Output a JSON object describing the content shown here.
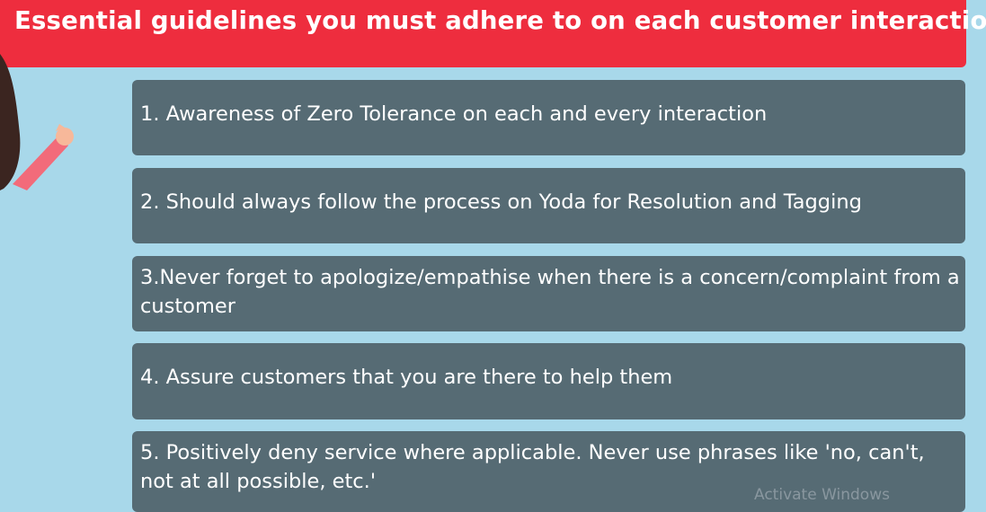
{
  "header": {
    "title": "Essential guidelines you must adhere to on each customer interaction"
  },
  "guidelines": [
    {
      "text": "1. Awareness of Zero Tolerance on each and every interaction"
    },
    {
      "text": "2. Should always follow the process on Yoda for Resolution and Tagging"
    },
    {
      "text": "3.Never forget to apologize/empathise when there is a concern/complaint from a customer"
    },
    {
      "text": "4. Assure customers that you are there to help them"
    },
    {
      "text": "5. Positively deny service where applicable. Never use phrases like 'no, can't, not at all possible, etc.'"
    }
  ],
  "watermark": {
    "text": "Activate Windows"
  },
  "colors": {
    "background": "#a8d8ea",
    "banner": "#ee2d3e",
    "card": "#566b74",
    "text": "#ffffff"
  },
  "illustration": {
    "icon": "woman-waving-illustration"
  }
}
